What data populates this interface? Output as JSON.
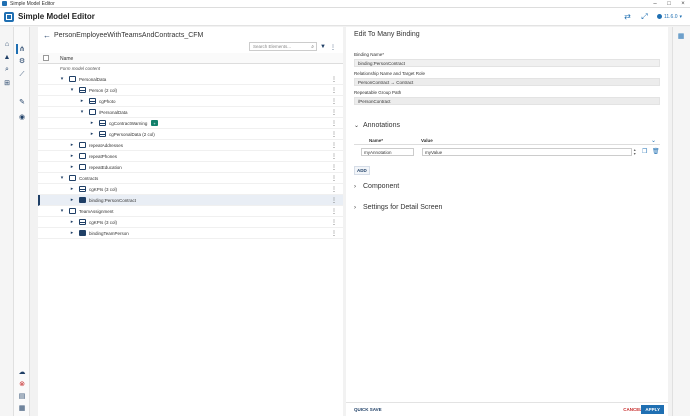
{
  "window": {
    "title": "Simple Model Editor"
  },
  "app": {
    "name": "Simple Model Editor",
    "version": "11.6.0"
  },
  "left": {
    "title": "PersonEmployeeWithTeamsAndContracts_CFM",
    "search_placeholder": "Search Elements...",
    "column_name": "Name",
    "empty_note": "Form model content",
    "rows": [
      {
        "label": "PersonalData",
        "level": 1
      },
      {
        "label": "Person (2 col)",
        "level": 2
      },
      {
        "label": "cgPhoto",
        "level": 3
      },
      {
        "label": "/PersonalData",
        "level": 3
      },
      {
        "label": "cgContractWarning",
        "level": 4,
        "badge": "+"
      },
      {
        "label": "cgPersonalData (2 col)",
        "level": 4
      },
      {
        "label": "repeatAddresses",
        "level": 2
      },
      {
        "label": "repeatPhones",
        "level": 2
      },
      {
        "label": "repeatEducation",
        "level": 2
      },
      {
        "label": "Contracts",
        "level": 1
      },
      {
        "label": "cgKPIs (3 col)",
        "level": 2
      },
      {
        "label": "binding:PersonContract",
        "level": 2
      },
      {
        "label": "TeamAssignment",
        "level": 1
      },
      {
        "label": "cgKPIs (3 col)",
        "level": 2
      },
      {
        "label": "bindingTeamPerson",
        "level": 2
      }
    ]
  },
  "right": {
    "title": "Edit To Many Binding",
    "binding_name_label": "Binding Name*",
    "binding_name_value": "binding:PersonContract",
    "relationship_label": "Relationship Name and Target Role",
    "relationship_value": "PersonContract → Contract",
    "repeatable_label": "Repeatable Group Path",
    "repeatable_value": "/PersonContract",
    "annotations_title": "Annotations",
    "ann_name_header": "Name*",
    "ann_value_header": "Value",
    "ann_name_value": "myAnnotation",
    "ann_value_value": "myValue",
    "add_label": "ADD",
    "component_title": "Component",
    "settings_title": "Settings for Detail Screen",
    "quicksave_label": "QUICK SAVE",
    "cancel_label": "CANCEL",
    "apply_label": "APPLY"
  }
}
